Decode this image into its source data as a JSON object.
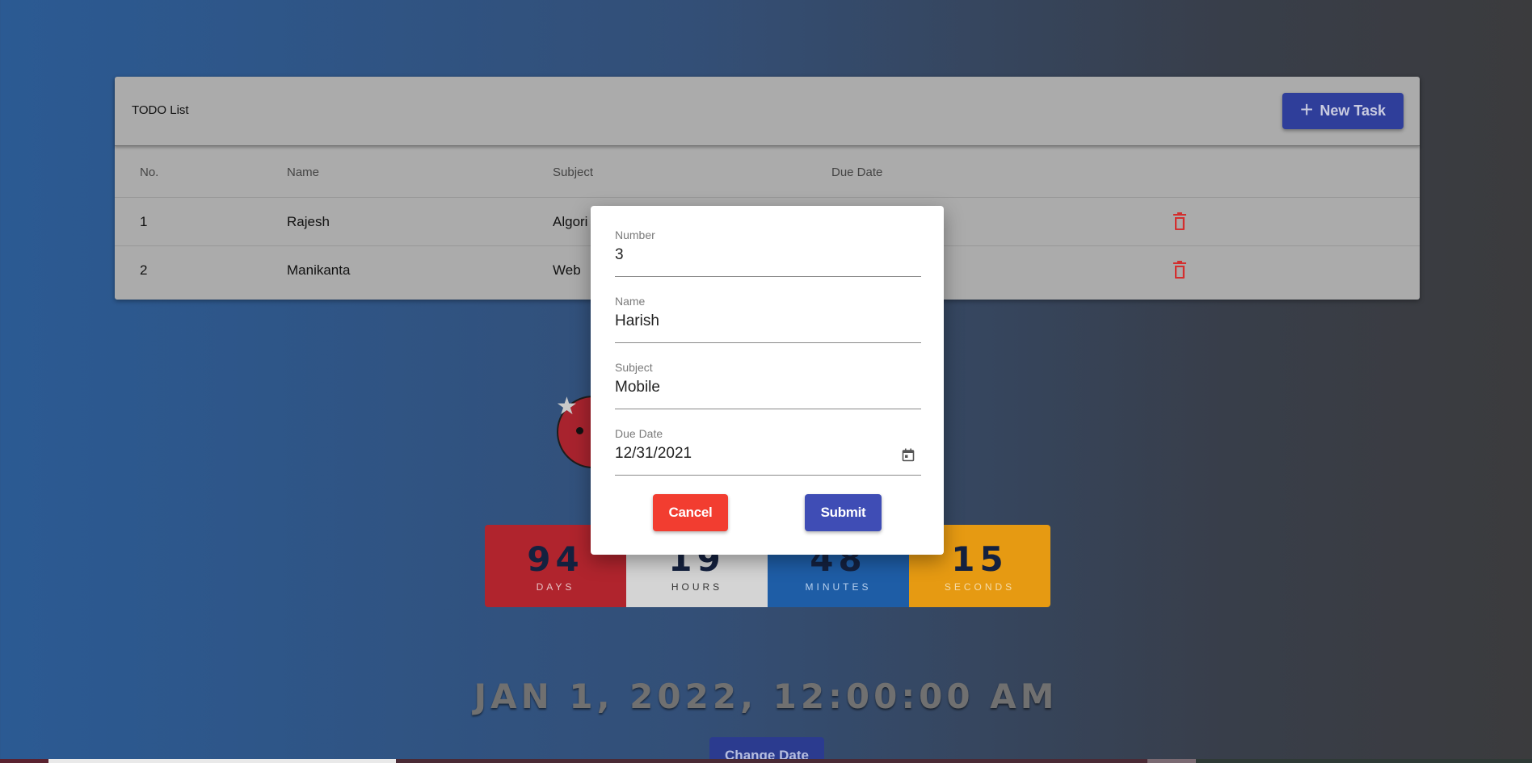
{
  "todo": {
    "title": "TODO List",
    "new_task_label": "New Task",
    "columns": [
      "No.",
      "Name",
      "Subject",
      "Due Date"
    ],
    "rows": [
      {
        "no": "1",
        "name": "Rajesh",
        "subject": "Algori"
      },
      {
        "no": "2",
        "name": "Manikanta",
        "subject": "Web"
      }
    ]
  },
  "countdown": {
    "days": {
      "value": "94",
      "label": "DAYS"
    },
    "hours": {
      "value": "19",
      "label": "HOURS"
    },
    "minutes": {
      "value": "48",
      "label": "MINUTES"
    },
    "seconds": {
      "value": "15",
      "label": "SECONDS"
    },
    "colors": {
      "days": "#b0242d",
      "hours": "#d4d4d4",
      "minutes": "#1e5da6",
      "seconds": "#e69a12"
    }
  },
  "target_date": "JAN 1, 2022, 12:00:00 AM",
  "change_date_label": "Change Date",
  "modal": {
    "number": {
      "label": "Number",
      "value": "3"
    },
    "name": {
      "label": "Name",
      "value": "Harish"
    },
    "subject": {
      "label": "Subject",
      "value": "Mobile"
    },
    "due_date": {
      "label": "Due Date",
      "value": "12/31/2021"
    },
    "cancel_label": "Cancel",
    "submit_label": "Submit",
    "colors": {
      "cancel": "#f23d30",
      "submit": "#3f4db5"
    }
  },
  "icons": {
    "new_task": "plus-icon",
    "row_action": "trash-icon",
    "date_picker": "calendar-icon",
    "decoration": "star-icon"
  }
}
